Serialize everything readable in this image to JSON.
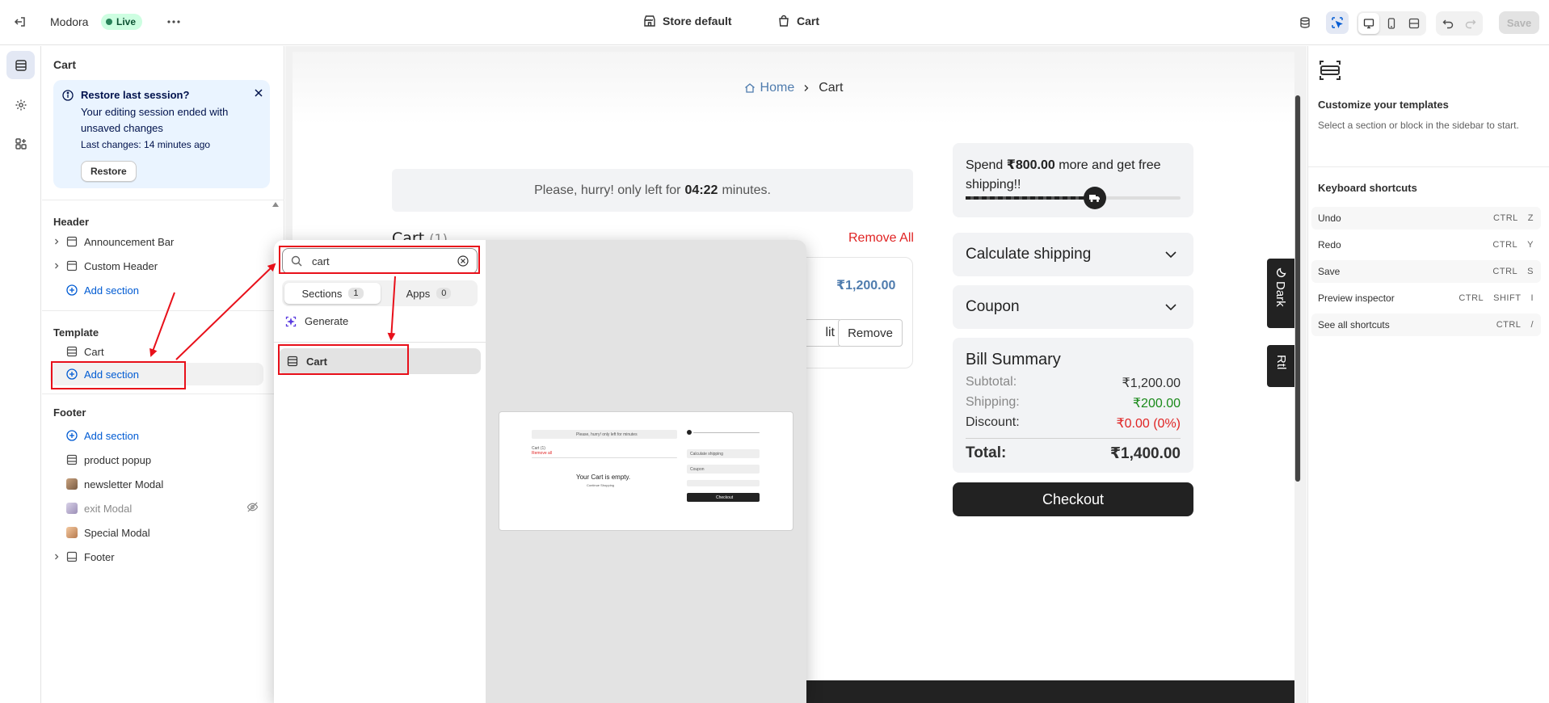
{
  "topbar": {
    "store_name": "Modora",
    "live_label": "Live",
    "template_label": "Store default",
    "page_label": "Cart",
    "save_label": "Save"
  },
  "sidebar": {
    "title": "Cart",
    "banner": {
      "title": "Restore last session?",
      "body": "Your editing session ended with unsaved changes",
      "last_changes": "Last changes: 14 minutes ago",
      "restore_label": "Restore"
    },
    "header_group": "Header",
    "header_items": [
      "Announcement Bar",
      "Custom Header"
    ],
    "add_section": "Add section",
    "template_group": "Template",
    "template_items": [
      "Cart"
    ],
    "footer_group": "Footer",
    "footer_items": [
      "product popup",
      "newsletter Modal",
      "exit Modal",
      "Special Modal",
      "Footer"
    ]
  },
  "preview": {
    "breadcrumb_home": "Home",
    "breadcrumb_current": "Cart",
    "hurry_prefix": "Please, hurry! only left for",
    "hurry_time": "04:22",
    "hurry_suffix": "minutes.",
    "cart_heading": "Cart",
    "cart_count": "(1)",
    "remove_all": "Remove All",
    "item_price": "₹1,200.00",
    "item_edit": "lit",
    "item_remove": "Remove",
    "shipping_prefix": "Spend",
    "shipping_amount": "₹800.00",
    "shipping_suffix": "more and get free shipping!!",
    "shipping_progress": 0.6,
    "calculate_shipping": "Calculate shipping",
    "coupon": "Coupon",
    "bill_title": "Bill Summary",
    "subtotal_label": "Subtotal:",
    "subtotal_value": "₹1,200.00",
    "shipping_label": "Shipping:",
    "shipping_value": "₹200.00",
    "discount_label": "Discount:",
    "discount_value": "₹0.00 (0%)",
    "total_label": "Total:",
    "total_value": "₹1,400.00",
    "checkout_label": "Checkout",
    "dark_label": "Dark",
    "rtl_label": "Rtl"
  },
  "popup": {
    "search_value": "cart",
    "tab_sections": "Sections",
    "tab_sections_count": "1",
    "tab_apps": "Apps",
    "tab_apps_count": "0",
    "generate_label": "Generate",
    "result_label": "Cart",
    "mini_hurry": "Please, hurry! only left for minutes",
    "mini_cart": "Cart (1)",
    "mini_remove": "Remove all",
    "mini_empty": "Your Cart is empty.",
    "mini_continue": "Continue Shopping",
    "mini_calc": "Calculate shipping",
    "mini_coupon": "Coupon",
    "mini_checkout": "Checkout"
  },
  "right_panel": {
    "title": "Customize your templates",
    "desc": "Select a section or block in the sidebar to start.",
    "shortcuts_title": "Keyboard shortcuts",
    "shortcuts": [
      {
        "label": "Undo",
        "keys": [
          "CTRL",
          "Z"
        ]
      },
      {
        "label": "Redo",
        "keys": [
          "CTRL",
          "Y"
        ]
      },
      {
        "label": "Save",
        "keys": [
          "CTRL",
          "S"
        ]
      },
      {
        "label": "Preview inspector",
        "keys": [
          "CTRL",
          "SHIFT",
          "I"
        ]
      },
      {
        "label": "See all shortcuts",
        "keys": [
          "CTRL",
          "/"
        ]
      }
    ]
  },
  "colors": {
    "accent_blue": "#005bd3",
    "annotation_red": "#e8101a",
    "live_green": "#29845a",
    "discount_red": "#e02424",
    "shipping_green": "#1a8a1a"
  }
}
